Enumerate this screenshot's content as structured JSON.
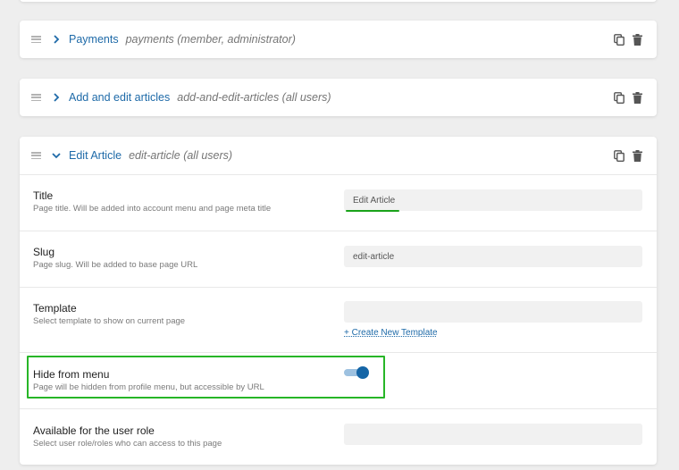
{
  "pages": [
    {
      "name": "Payments",
      "slug": "payments (member, administrator)",
      "expanded": false
    },
    {
      "name": "Add and edit articles",
      "slug": "add-and-edit-articles (all users)",
      "expanded": false
    },
    {
      "name": "Edit Article",
      "slug": "edit-article (all users)",
      "expanded": true
    }
  ],
  "icons": {
    "drag": "drag-handle-icon",
    "collapsed": "chevron-right-icon",
    "expanded": "chevron-down-icon",
    "copy": "copy-icon",
    "delete": "trash-icon"
  },
  "settings": {
    "title": {
      "label": "Title",
      "description": "Page title. Will be added into account menu and page meta title",
      "value": "Edit Article"
    },
    "slug": {
      "label": "Slug",
      "description": "Page slug. Will be added to base page URL",
      "value": "edit-article"
    },
    "template": {
      "label": "Template",
      "description": "Select template to show on current page",
      "value": "",
      "create_link": "+ Create New Template"
    },
    "hide_from_menu": {
      "label": "Hide from menu",
      "description": "Page will be hidden from profile menu, but accessible by URL",
      "enabled": true
    },
    "user_role": {
      "label": "Available for the user role",
      "description": "Select user role/roles who can access to this page",
      "value": ""
    }
  },
  "colors": {
    "accent": "#1e6aa8",
    "toggle_on": "#1565a6",
    "highlight": "#27b627"
  }
}
